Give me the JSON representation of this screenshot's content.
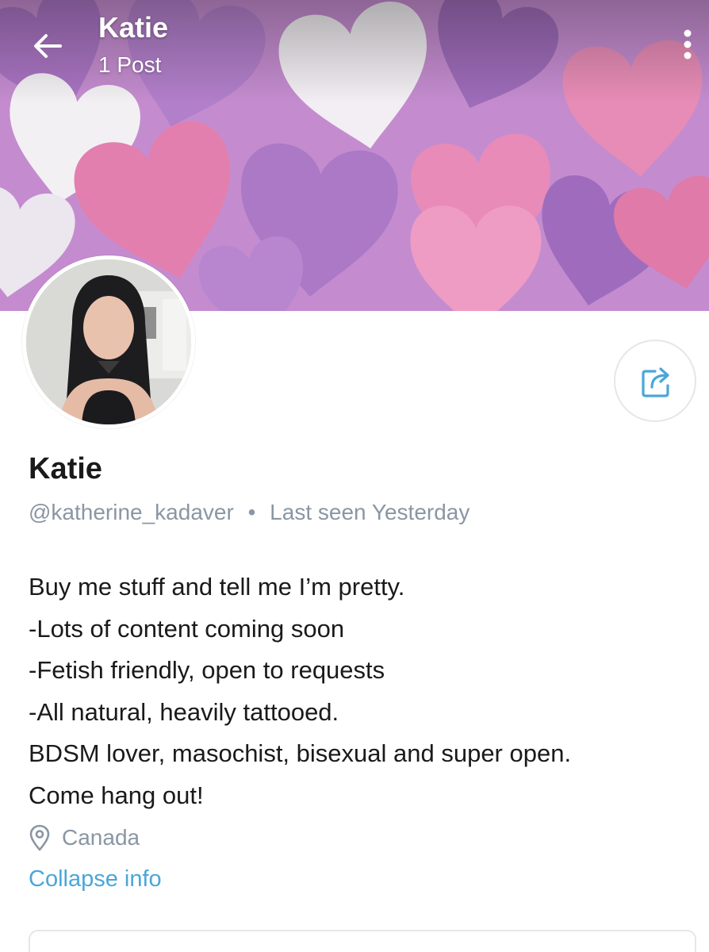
{
  "header": {
    "name": "Katie",
    "post_count": "1 Post"
  },
  "profile": {
    "display_name": "Katie",
    "username": "@katherine_kadaver",
    "separator": "•",
    "last_seen": "Last seen Yesterday",
    "bio_lines": [
      "Buy me stuff and tell me I’m pretty.",
      "-Lots of content coming soon",
      "-Fetish friendly, open to requests",
      "-All natural, heavily tattooed.",
      "BDSM lover, masochist, bisexual and super open.",
      "Come hang out!"
    ],
    "location": "Canada",
    "collapse_label": "Collapse info"
  },
  "icons": {
    "back": "arrow-left-icon",
    "more": "more-vertical-icon",
    "share": "share-icon",
    "location": "location-pin-icon"
  },
  "colors": {
    "accent": "#4aa6d9",
    "muted_text": "#8a96a3",
    "primary_text": "#1a1a1a"
  }
}
